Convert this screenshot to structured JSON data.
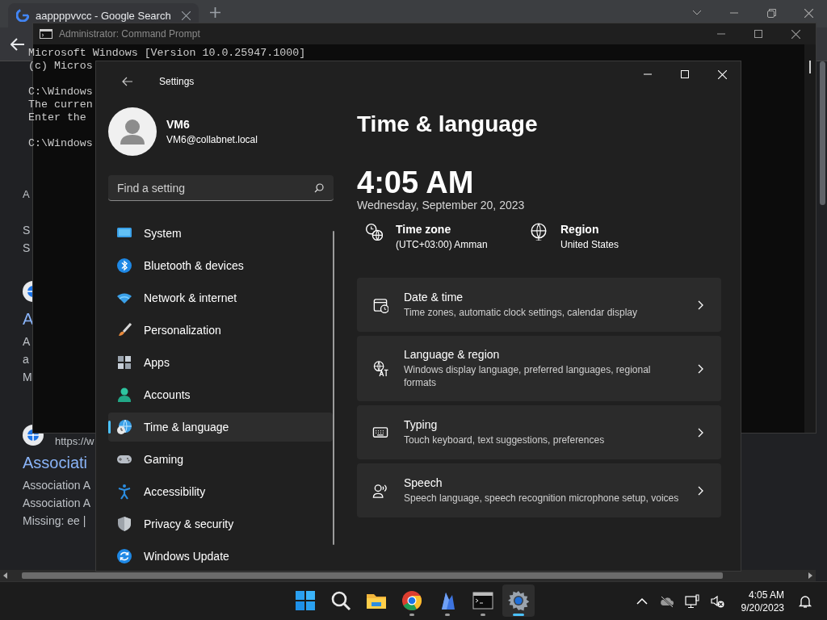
{
  "browser": {
    "tab": {
      "title": "aappppvvcc - Google Search"
    },
    "results": [
      {
        "kind": "header",
        "lines": [
          "A"
        ]
      },
      {
        "kind": "snippet",
        "lines": [
          "S",
          "S"
        ]
      },
      {
        "kind": "site",
        "title": "A",
        "lines": [
          "A",
          "a",
          "M"
        ]
      },
      {
        "kind": "site",
        "url": "https://w",
        "title": "Associati",
        "lines": [
          "Association A",
          "Association A",
          "Missing: ee |"
        ]
      }
    ]
  },
  "command_prompt": {
    "title": "Administrator: Command Prompt",
    "paragraphs": [
      {
        "lines": [
          "Microsoft Windows [Version 10.0.25947.1000]",
          "(c) Micros"
        ]
      },
      {
        "lines": [
          "C:\\Windows",
          "The curren",
          "Enter the"
        ]
      },
      {
        "lines": [
          "C:\\Windows"
        ]
      }
    ]
  },
  "settings": {
    "title": "Settings",
    "user": {
      "name": "VM6",
      "email": "VM6@collabnet.local"
    },
    "search": {
      "placeholder": "Find a setting"
    },
    "nav_items": [
      {
        "label": "System",
        "selected": false
      },
      {
        "label": "Bluetooth & devices",
        "selected": false
      },
      {
        "label": "Network & internet",
        "selected": false
      },
      {
        "label": "Personalization",
        "selected": false
      },
      {
        "label": "Apps",
        "selected": false
      },
      {
        "label": "Accounts",
        "selected": false
      },
      {
        "label": "Time & language",
        "selected": true
      },
      {
        "label": "Gaming",
        "selected": false
      },
      {
        "label": "Accessibility",
        "selected": false
      },
      {
        "label": "Privacy & security",
        "selected": false
      },
      {
        "label": "Windows Update",
        "selected": false
      }
    ],
    "page_title": "Time & language",
    "time": "4:05 AM",
    "date": "Wednesday, September 20, 2023",
    "info": [
      {
        "label": "Time zone",
        "value": "(UTC+03:00) Amman"
      },
      {
        "label": "Region",
        "value": "United States"
      }
    ],
    "cards": [
      {
        "title": "Date & time",
        "description": "Time zones, automatic clock settings, calendar display"
      },
      {
        "title": "Language & region",
        "description": "Windows display language, preferred languages, regional formats"
      },
      {
        "title": "Typing",
        "description": "Touch keyboard, text suggestions, preferences"
      },
      {
        "title": "Speech",
        "description": "Speech language, speech recognition microphone setup, voices"
      }
    ]
  },
  "taskbar": {
    "apps": [
      {
        "running": false,
        "selected": false
      },
      {
        "running": false,
        "selected": false
      },
      {
        "running": false,
        "selected": false
      },
      {
        "running": true,
        "selected": false
      },
      {
        "running": true,
        "selected": false
      },
      {
        "running": true,
        "selected": false
      },
      {
        "running": true,
        "selected": true
      }
    ],
    "clock": {
      "time": "4:05 AM",
      "date": "9/20/2023"
    }
  }
}
